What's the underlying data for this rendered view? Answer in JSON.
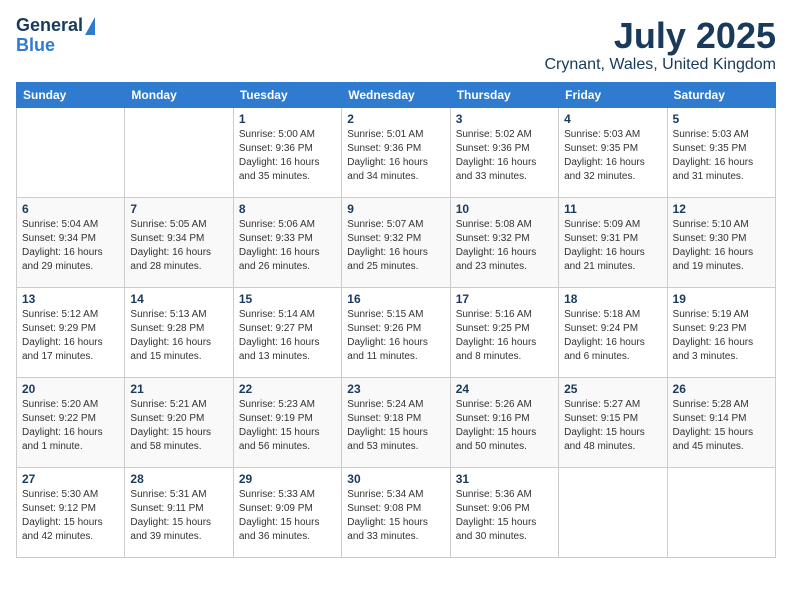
{
  "logo": {
    "line1": "General",
    "line2": "Blue"
  },
  "title": "July 2025",
  "location": "Crynant, Wales, United Kingdom",
  "weekdays": [
    "Sunday",
    "Monday",
    "Tuesday",
    "Wednesday",
    "Thursday",
    "Friday",
    "Saturday"
  ],
  "weeks": [
    [
      {
        "day": "",
        "info": ""
      },
      {
        "day": "",
        "info": ""
      },
      {
        "day": "1",
        "info": "Sunrise: 5:00 AM\nSunset: 9:36 PM\nDaylight: 16 hours and 35 minutes."
      },
      {
        "day": "2",
        "info": "Sunrise: 5:01 AM\nSunset: 9:36 PM\nDaylight: 16 hours and 34 minutes."
      },
      {
        "day": "3",
        "info": "Sunrise: 5:02 AM\nSunset: 9:36 PM\nDaylight: 16 hours and 33 minutes."
      },
      {
        "day": "4",
        "info": "Sunrise: 5:03 AM\nSunset: 9:35 PM\nDaylight: 16 hours and 32 minutes."
      },
      {
        "day": "5",
        "info": "Sunrise: 5:03 AM\nSunset: 9:35 PM\nDaylight: 16 hours and 31 minutes."
      }
    ],
    [
      {
        "day": "6",
        "info": "Sunrise: 5:04 AM\nSunset: 9:34 PM\nDaylight: 16 hours and 29 minutes."
      },
      {
        "day": "7",
        "info": "Sunrise: 5:05 AM\nSunset: 9:34 PM\nDaylight: 16 hours and 28 minutes."
      },
      {
        "day": "8",
        "info": "Sunrise: 5:06 AM\nSunset: 9:33 PM\nDaylight: 16 hours and 26 minutes."
      },
      {
        "day": "9",
        "info": "Sunrise: 5:07 AM\nSunset: 9:32 PM\nDaylight: 16 hours and 25 minutes."
      },
      {
        "day": "10",
        "info": "Sunrise: 5:08 AM\nSunset: 9:32 PM\nDaylight: 16 hours and 23 minutes."
      },
      {
        "day": "11",
        "info": "Sunrise: 5:09 AM\nSunset: 9:31 PM\nDaylight: 16 hours and 21 minutes."
      },
      {
        "day": "12",
        "info": "Sunrise: 5:10 AM\nSunset: 9:30 PM\nDaylight: 16 hours and 19 minutes."
      }
    ],
    [
      {
        "day": "13",
        "info": "Sunrise: 5:12 AM\nSunset: 9:29 PM\nDaylight: 16 hours and 17 minutes."
      },
      {
        "day": "14",
        "info": "Sunrise: 5:13 AM\nSunset: 9:28 PM\nDaylight: 16 hours and 15 minutes."
      },
      {
        "day": "15",
        "info": "Sunrise: 5:14 AM\nSunset: 9:27 PM\nDaylight: 16 hours and 13 minutes."
      },
      {
        "day": "16",
        "info": "Sunrise: 5:15 AM\nSunset: 9:26 PM\nDaylight: 16 hours and 11 minutes."
      },
      {
        "day": "17",
        "info": "Sunrise: 5:16 AM\nSunset: 9:25 PM\nDaylight: 16 hours and 8 minutes."
      },
      {
        "day": "18",
        "info": "Sunrise: 5:18 AM\nSunset: 9:24 PM\nDaylight: 16 hours and 6 minutes."
      },
      {
        "day": "19",
        "info": "Sunrise: 5:19 AM\nSunset: 9:23 PM\nDaylight: 16 hours and 3 minutes."
      }
    ],
    [
      {
        "day": "20",
        "info": "Sunrise: 5:20 AM\nSunset: 9:22 PM\nDaylight: 16 hours and 1 minute."
      },
      {
        "day": "21",
        "info": "Sunrise: 5:21 AM\nSunset: 9:20 PM\nDaylight: 15 hours and 58 minutes."
      },
      {
        "day": "22",
        "info": "Sunrise: 5:23 AM\nSunset: 9:19 PM\nDaylight: 15 hours and 56 minutes."
      },
      {
        "day": "23",
        "info": "Sunrise: 5:24 AM\nSunset: 9:18 PM\nDaylight: 15 hours and 53 minutes."
      },
      {
        "day": "24",
        "info": "Sunrise: 5:26 AM\nSunset: 9:16 PM\nDaylight: 15 hours and 50 minutes."
      },
      {
        "day": "25",
        "info": "Sunrise: 5:27 AM\nSunset: 9:15 PM\nDaylight: 15 hours and 48 minutes."
      },
      {
        "day": "26",
        "info": "Sunrise: 5:28 AM\nSunset: 9:14 PM\nDaylight: 15 hours and 45 minutes."
      }
    ],
    [
      {
        "day": "27",
        "info": "Sunrise: 5:30 AM\nSunset: 9:12 PM\nDaylight: 15 hours and 42 minutes."
      },
      {
        "day": "28",
        "info": "Sunrise: 5:31 AM\nSunset: 9:11 PM\nDaylight: 15 hours and 39 minutes."
      },
      {
        "day": "29",
        "info": "Sunrise: 5:33 AM\nSunset: 9:09 PM\nDaylight: 15 hours and 36 minutes."
      },
      {
        "day": "30",
        "info": "Sunrise: 5:34 AM\nSunset: 9:08 PM\nDaylight: 15 hours and 33 minutes."
      },
      {
        "day": "31",
        "info": "Sunrise: 5:36 AM\nSunset: 9:06 PM\nDaylight: 15 hours and 30 minutes."
      },
      {
        "day": "",
        "info": ""
      },
      {
        "day": "",
        "info": ""
      }
    ]
  ]
}
